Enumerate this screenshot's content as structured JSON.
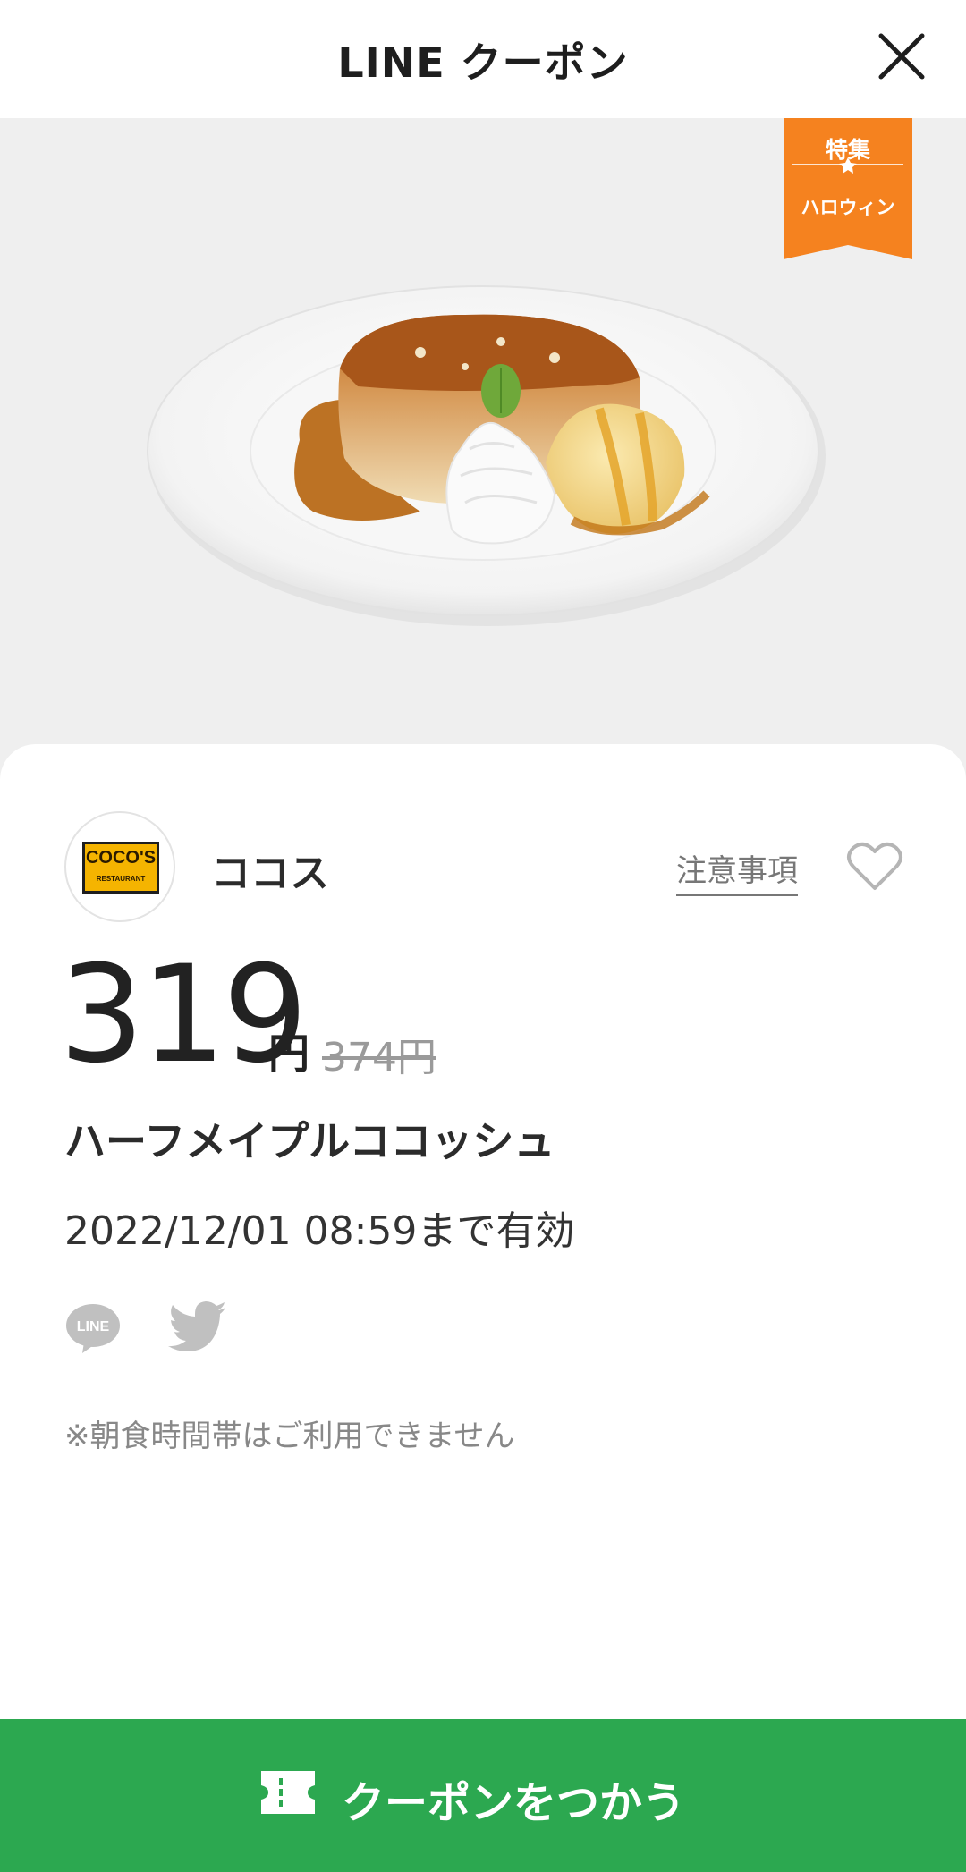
{
  "header": {
    "title": "LINE クーポン",
    "close_icon": "close-icon"
  },
  "hero": {
    "image_description": "food photo",
    "badge": {
      "top": "特集",
      "bottom": "ハロウィン",
      "color": "#F5821F"
    }
  },
  "coupon": {
    "shop_logo_text": "COCO'S",
    "shop_logo_subtext": "RESTAURANT",
    "shop_name": "ココス",
    "notes_link": "注意事項",
    "favorite_icon": "heart-icon",
    "price": "319",
    "currency": "円",
    "original_price": "374円",
    "product_name": "ハーフメイプルココッシュ",
    "valid_until": "2022/12/01 08:59まで有効",
    "share": {
      "line_icon": "line-icon",
      "line_label": "LINE",
      "twitter_icon": "twitter-icon"
    },
    "note": "※朝食時間帯はご利用できません"
  },
  "cta": {
    "label": "クーポンをつかう",
    "icon": "ticket-icon",
    "color": "#2CA850"
  }
}
